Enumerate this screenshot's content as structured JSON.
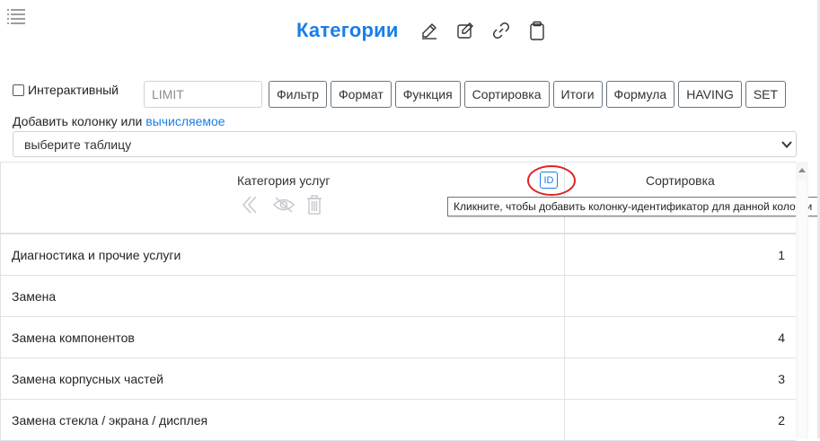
{
  "header": {
    "title": "Категории",
    "menu_icon": "list-menu-icon",
    "title_icons": [
      "pencil-icon",
      "edit-square-icon",
      "link-icon",
      "clipboard-icon"
    ],
    "accent_color": "#1a7ee8"
  },
  "toolbar": {
    "interactive_label": "Интерактивный",
    "interactive_checked": false,
    "limit_placeholder": "LIMIT",
    "buttons": [
      "Фильтр",
      "Формат",
      "Функция",
      "Сортировка",
      "Итоги",
      "Формула",
      "HAVING",
      "SET"
    ]
  },
  "add_column": {
    "prefix": "Добавить колонку или ",
    "link": "вычисляемое"
  },
  "table_select": {
    "value": "выберите таблицу"
  },
  "table": {
    "columns": [
      {
        "label": "Категория услуг",
        "actions": [
          "chevron-left-double-icon",
          "eye-off-icon",
          "trash-icon"
        ]
      },
      {
        "label": "Сортировка"
      }
    ],
    "id_button": "ID",
    "id_tooltip": "Кликните, чтобы добавить колонку-идентификатор для данной колонки",
    "rows": [
      {
        "name": "Диагностика и прочие услуги",
        "sort": "1"
      },
      {
        "name": "Замена",
        "sort": ""
      },
      {
        "name": "Замена компонентов",
        "sort": "4"
      },
      {
        "name": "Замена корпусных частей",
        "sort": "3"
      },
      {
        "name": "Замена стекла / экрана / дисплея",
        "sort": "2"
      }
    ]
  }
}
